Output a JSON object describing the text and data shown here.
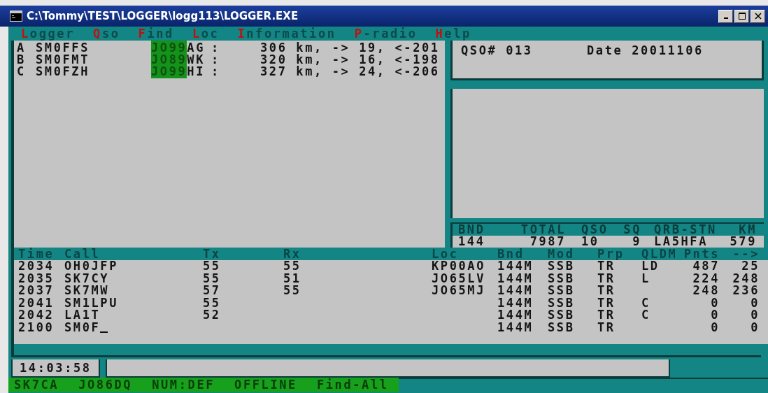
{
  "window": {
    "title": "C:\\Tommy\\TEST\\LOGGER\\logg113\\LOGGER.EXE"
  },
  "menu": [
    {
      "label": "Logger"
    },
    {
      "label": "Qso"
    },
    {
      "label": "Find"
    },
    {
      "label": "Loc"
    },
    {
      "label": "Information"
    },
    {
      "label": "P-radio"
    },
    {
      "label": "Help"
    }
  ],
  "stations": [
    {
      "slot": "A",
      "call": "SM0FFS",
      "locator": "JO99AG",
      "separator": ":",
      "info": "306 km, -> 19, <-201"
    },
    {
      "slot": "B",
      "call": "SM0FMT",
      "locator": "JO89WK",
      "separator": ":",
      "info": "320 km, -> 16, <-198"
    },
    {
      "slot": "C",
      "call": "SM0FZH",
      "locator": "JO99HI",
      "separator": ":",
      "info": "327 km, -> 24, <-206"
    }
  ],
  "qso_box": {
    "number": "QSO# 013",
    "date": "Date 20011106"
  },
  "stats": {
    "columns": [
      "BND",
      "TOTAL",
      "QSO",
      "SQ",
      "QRB-STN",
      "KM"
    ],
    "values": [
      "144",
      "7987",
      "10",
      "9",
      "LA5HFA",
      "579"
    ]
  },
  "log": {
    "columns": [
      "Time",
      "Call",
      "Tx",
      "Rx",
      "Loc",
      "Bnd",
      "Mod",
      "Prp",
      "QLDM",
      "Pnts",
      "-->"
    ],
    "rows": [
      {
        "time": "2034",
        "call": "OH0JFP",
        "tx": "55",
        "rx": "55",
        "loc": "KP00AO",
        "bnd": "144M",
        "mod": "SSB",
        "prp": "TR",
        "qldm": "LD",
        "pnts": "487",
        "col_11": "25"
      },
      {
        "time": "2035",
        "call": "SK7CY",
        "tx": "55",
        "rx": "51",
        "loc": "JO65LV",
        "bnd": "144M",
        "mod": "SSB",
        "prp": "TR",
        "qldm": "L",
        "pnts": "224",
        "col_11": "248"
      },
      {
        "time": "2037",
        "call": "SK7MW",
        "tx": "57",
        "rx": "55",
        "loc": "JO65MJ",
        "bnd": "144M",
        "mod": "SSB",
        "prp": "TR",
        "pnts": "248",
        "col_11": "236"
      },
      {
        "time": "2041",
        "call": "SM1LPU",
        "tx": "55",
        "bnd": "144M",
        "mod": "SSB",
        "prp": "TR",
        "qldm": "C",
        "pnts": "0",
        "col_11": "0"
      },
      {
        "time": "2042",
        "call": "LA1T",
        "tx": "52",
        "bnd": "144M",
        "mod": "SSB",
        "prp": "TR",
        "qldm": "C",
        "pnts": "0",
        "col_11": "0"
      }
    ],
    "entry_row": {
      "time": "2100",
      "call": "SM0F",
      "bnd": "144M",
      "mod": "SSB",
      "prp": "TR",
      "pnts": "0",
      "col_11": "0",
      "cursor": true
    }
  },
  "clock": "14:03:58",
  "status_bar": [
    "SK7CA",
    "JO86DQ",
    "NUM:DEF",
    "OFFLINE",
    "Find-All"
  ]
}
